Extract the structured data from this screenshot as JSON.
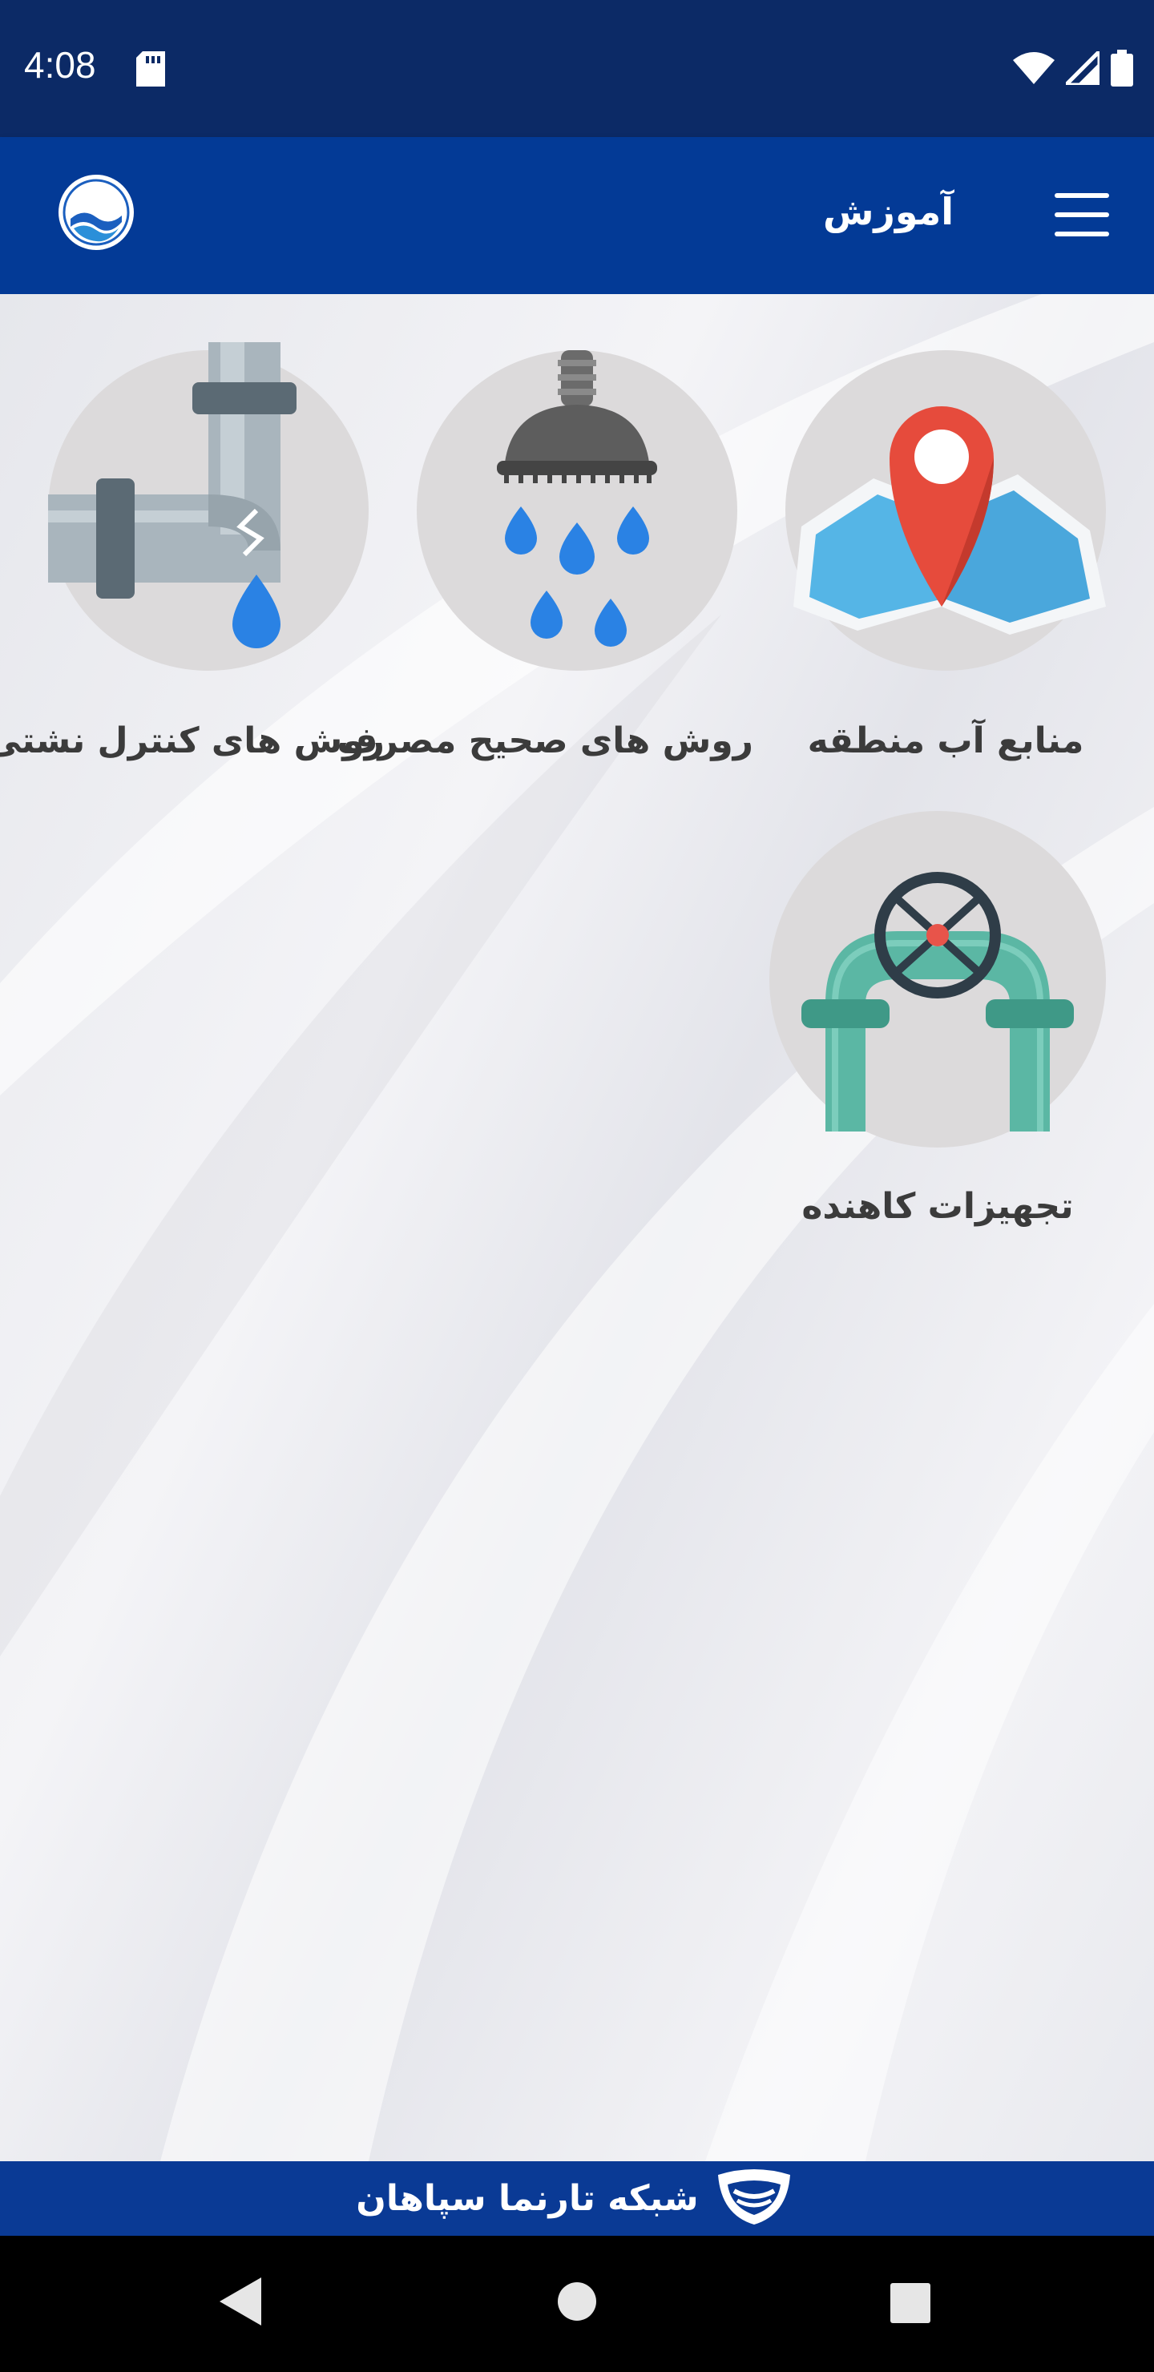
{
  "status_bar": {
    "time": "4:08",
    "icons": [
      "sd-card-icon",
      "wifi-icon",
      "signal-icon",
      "battery-icon"
    ]
  },
  "app_bar": {
    "title": "آموزش",
    "menu_icon": "hamburger-menu-icon",
    "logo_icon": "water-company-logo"
  },
  "tiles": [
    {
      "label": "منابع آب منطقه",
      "icon": "map-pin-icon"
    },
    {
      "label": "روش های صحیح مصرف",
      "icon": "shower-head-icon"
    },
    {
      "label": "روش های کنترل نشتی",
      "icon": "leaking-pipe-icon"
    },
    {
      "label": "تجهیزات کاهنده",
      "icon": "valve-pipe-icon"
    }
  ],
  "footer": {
    "text": "شبکه تارنما سپاهان",
    "logo_icon": "sepahan-logo-icon"
  },
  "nav_bar": {
    "buttons": [
      "back-icon",
      "home-icon",
      "recents-icon"
    ]
  },
  "colors": {
    "status_bar": "#0c2a66",
    "app_bar": "#033a96",
    "footer": "#0a3a95",
    "tile_circle": "#dcdadb",
    "label_text": "#3b3b3b"
  }
}
